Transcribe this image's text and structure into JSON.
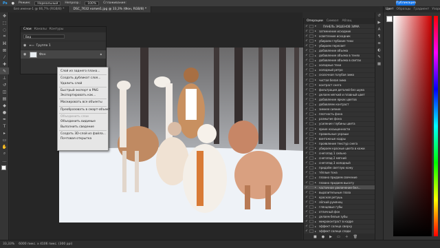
{
  "options_bar": {
    "mode_label": "Режим:",
    "mode_value": "Нормальный",
    "opacity_label": "Непрозр.:",
    "opacity_value": "100%",
    "smoothing_label": "Сглаживание:",
    "publish": "Публикация"
  },
  "tabs": [
    {
      "label": "Без имени-1 @ 66,7% (RGB/8) *",
      "active": false
    },
    {
      "label": "DSC_7632 копия1.jpg @ 33,3% (Фон, RGB/8) *",
      "active": true
    }
  ],
  "layers_panel": {
    "tabs": [
      "Слои",
      "Каналы",
      "Контуры"
    ],
    "search": "Вид",
    "rows": [
      {
        "name": "Группа 1",
        "selected": false
      },
      {
        "name": "Фон",
        "selected": true
      }
    ]
  },
  "context_menu": {
    "groups": [
      [
        {
          "label": "Слой из заднего плана...",
          "disabled": false
        }
      ],
      [
        {
          "label": "Создать дубликат слоя...",
          "disabled": false
        },
        {
          "label": "Удалить слой",
          "disabled": false
        }
      ],
      [
        {
          "label": "Быстрый экспорт в PNG",
          "disabled": false
        },
        {
          "label": "Экспортировать как...",
          "disabled": false
        }
      ],
      [
        {
          "label": "Маскировать все объекты",
          "disabled": false
        }
      ],
      [
        {
          "label": "Преобразовать в смарт-объект",
          "disabled": false
        }
      ],
      [
        {
          "label": "Объединить слои",
          "disabled": true
        },
        {
          "label": "Объединить видимые",
          "disabled": false
        },
        {
          "label": "Выполнить сведение",
          "disabled": false
        }
      ],
      [
        {
          "label": "Создать 3D-слой из файла...",
          "disabled": false
        },
        {
          "label": "Почтовая открытка",
          "disabled": false
        }
      ]
    ]
  },
  "actions_panel": {
    "tabs": [
      "Операции",
      "Символ",
      "Абзац"
    ],
    "items": [
      {
        "label": "ПАНЕЛЬ ЭКШЕНОВ ЗИМА",
        "header": true,
        "highlight": false
      },
      {
        "label": "затемнение исходник",
        "header": false,
        "highlight": false
      },
      {
        "label": "осветление исходник",
        "header": false,
        "highlight": false
      },
      {
        "label": "убираем глубокие тени",
        "header": false,
        "highlight": false
      },
      {
        "label": "убираем пересвет",
        "header": false,
        "highlight": false
      },
      {
        "label": "добавление объема",
        "header": false,
        "highlight": false
      },
      {
        "label": "добавление объема в тенях",
        "header": false,
        "highlight": false
      },
      {
        "label": "добавление объема в светах",
        "header": false,
        "highlight": false
      },
      {
        "label": "холодные тени",
        "header": false,
        "highlight": false
      },
      {
        "label": "холодный ретро",
        "header": false,
        "highlight": false
      },
      {
        "label": "сказочная голубая зима",
        "header": false,
        "highlight": false
      },
      {
        "label": "чистая белая зима",
        "header": false,
        "highlight": false
      },
      {
        "label": "контраст снега",
        "header": false,
        "highlight": false
      },
      {
        "label": "фильтрация деталей без шума",
        "header": false,
        "highlight": false
      },
      {
        "label": "делаем мягкий и плавный цвет",
        "header": false,
        "highlight": false
      },
      {
        "label": "добавление ярких цветов",
        "header": false,
        "highlight": false
      },
      {
        "label": "добавляем контраст",
        "header": false,
        "highlight": false
      },
      {
        "label": "зимнее сияние",
        "header": false,
        "highlight": false
      },
      {
        "label": "плотность фона",
        "header": false,
        "highlight": false
      },
      {
        "label": "размытие фона",
        "header": false,
        "highlight": false
      },
      {
        "label": "усиление глубины цвета",
        "header": false,
        "highlight": false
      },
      {
        "label": "яркие насыщенности",
        "header": false,
        "highlight": false
      },
      {
        "label": "правильные украши",
        "header": false,
        "highlight": false
      },
      {
        "label": "винтажные кадры",
        "header": false,
        "highlight": false
      },
      {
        "label": "проявление текстур снега",
        "header": false,
        "highlight": false
      },
      {
        "label": "убираем красные цвета в кожи",
        "header": false,
        "highlight": false
      },
      {
        "label": "снегопад 1 сильно",
        "header": false,
        "highlight": false
      },
      {
        "label": "снегопад 2 мягкий",
        "header": false,
        "highlight": false
      },
      {
        "label": "снегопад 3 холодный",
        "header": false,
        "highlight": false
      },
      {
        "label": "придаём светлую кожу",
        "header": false,
        "highlight": false
      },
      {
        "label": "тёплые тона",
        "header": false,
        "highlight": false
      },
      {
        "label": "плавно придаем свечение",
        "header": false,
        "highlight": false
      },
      {
        "label": "плавно придаем высоту",
        "header": false,
        "highlight": false
      },
      {
        "label": "частичное увеличение бел...",
        "header": false,
        "highlight": true
      },
      {
        "label": "выразительные глаза",
        "header": false,
        "highlight": false
      },
      {
        "label": "красная ретушь",
        "header": false,
        "highlight": false
      },
      {
        "label": "лёгкий румянец",
        "header": false,
        "highlight": false
      },
      {
        "label": "глянцевые губы",
        "header": false,
        "highlight": false
      },
      {
        "label": "отличный фон",
        "header": false,
        "highlight": false
      },
      {
        "label": "делаем белые зубы",
        "header": false,
        "highlight": false
      },
      {
        "label": "микроконтраст в кадре",
        "header": false,
        "highlight": false
      },
      {
        "label": "эффект солнца сверху",
        "header": false,
        "highlight": false
      },
      {
        "label": "эффект солнца сзади",
        "header": false,
        "highlight": false
      },
      {
        "label": "зимний холод",
        "header": false,
        "highlight": false
      },
      {
        "label": "лёгкий мягкий эффект",
        "header": false,
        "highlight": false
      }
    ]
  },
  "color_panel": {
    "tabs": [
      "Цвет",
      "Образцы",
      "Градиент",
      "Узоры"
    ],
    "foreground": "#ffffff",
    "background": "#111111"
  },
  "status": {
    "zoom": "33,33%",
    "dimensions": "6000 пикс. x 4106 пикс. (300 ppi)"
  }
}
